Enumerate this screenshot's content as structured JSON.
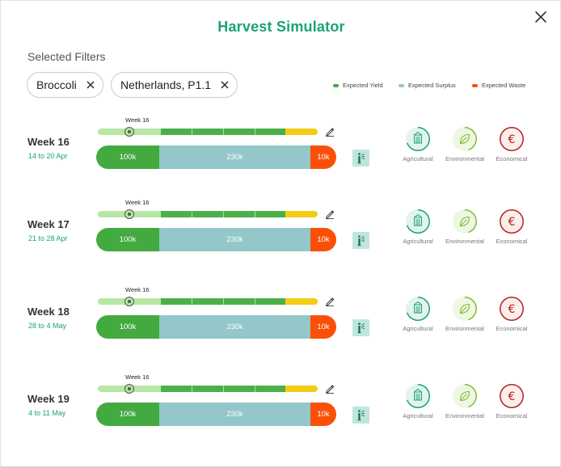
{
  "dialog": {
    "title": "Harvest Simulator"
  },
  "filters": {
    "label": "Selected Filters",
    "chips": [
      {
        "label": "Broccoli"
      },
      {
        "label": "Netherlands, P1.1"
      }
    ]
  },
  "legend": [
    {
      "label": "Expected Yield",
      "color": "#43aa3f"
    },
    {
      "label": "Expected Surplus",
      "color": "#93c7c9"
    },
    {
      "label": "Expected Waste",
      "color": "#fb4f08"
    }
  ],
  "impact_labels": {
    "agricultural": "Agricultural",
    "environmental": "Environmental",
    "economical": "Economical"
  },
  "weeks": [
    {
      "name": "Week 16",
      "range": "14 to 20 Apr",
      "slider_label": "Week 16",
      "yield": "100k",
      "surplus": "230k",
      "waste": "10k"
    },
    {
      "name": "Week 17",
      "range": "21 to 28 Apr",
      "slider_label": "Week 16",
      "yield": "100k",
      "surplus": "230k",
      "waste": "10k"
    },
    {
      "name": "Week 18",
      "range": "28 to 4 May",
      "slider_label": "Week 16",
      "yield": "100k",
      "surplus": "230k",
      "waste": "10k"
    },
    {
      "name": "Week 19",
      "range": "4 to 11 May",
      "slider_label": "Week 16",
      "yield": "100k",
      "surplus": "230k",
      "waste": "10k"
    }
  ],
  "colors": {
    "accent": "#1aa37a",
    "agricultural": "#1aa37a",
    "environmental": "#7cbf2f",
    "economical": "#b1261b"
  }
}
